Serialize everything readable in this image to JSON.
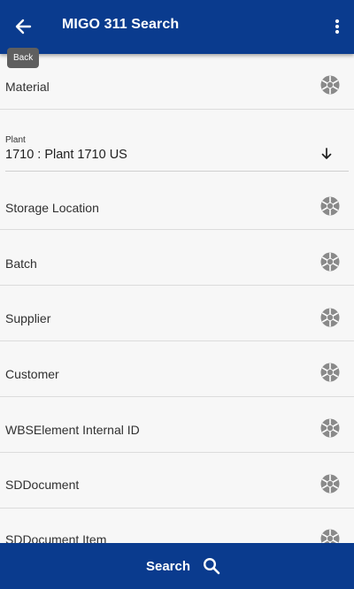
{
  "header": {
    "title": "MIGO 311 Search",
    "back_tooltip": "Back"
  },
  "fields": [
    {
      "label": "Material"
    },
    {
      "label": "Storage Location"
    },
    {
      "label": "Batch"
    },
    {
      "label": "Supplier"
    },
    {
      "label": "Customer"
    },
    {
      "label": "WBSElement Internal ID"
    },
    {
      "label": "SDDocument"
    },
    {
      "label": "SDDocument Item"
    }
  ],
  "plant": {
    "label": "Plant",
    "value": "1710 : Plant 1710 US"
  },
  "footer": {
    "search_label": "Search"
  },
  "colors": {
    "primary": "#0a3b8e",
    "background": "#f7f7f7",
    "icon_gray": "#8a8a8a"
  },
  "icons": {
    "back": "arrow-left-icon",
    "menu": "more-vertical-icon",
    "scan": "barcode-scan-icon",
    "dropdown": "arrow-down-icon",
    "search": "search-icon"
  }
}
